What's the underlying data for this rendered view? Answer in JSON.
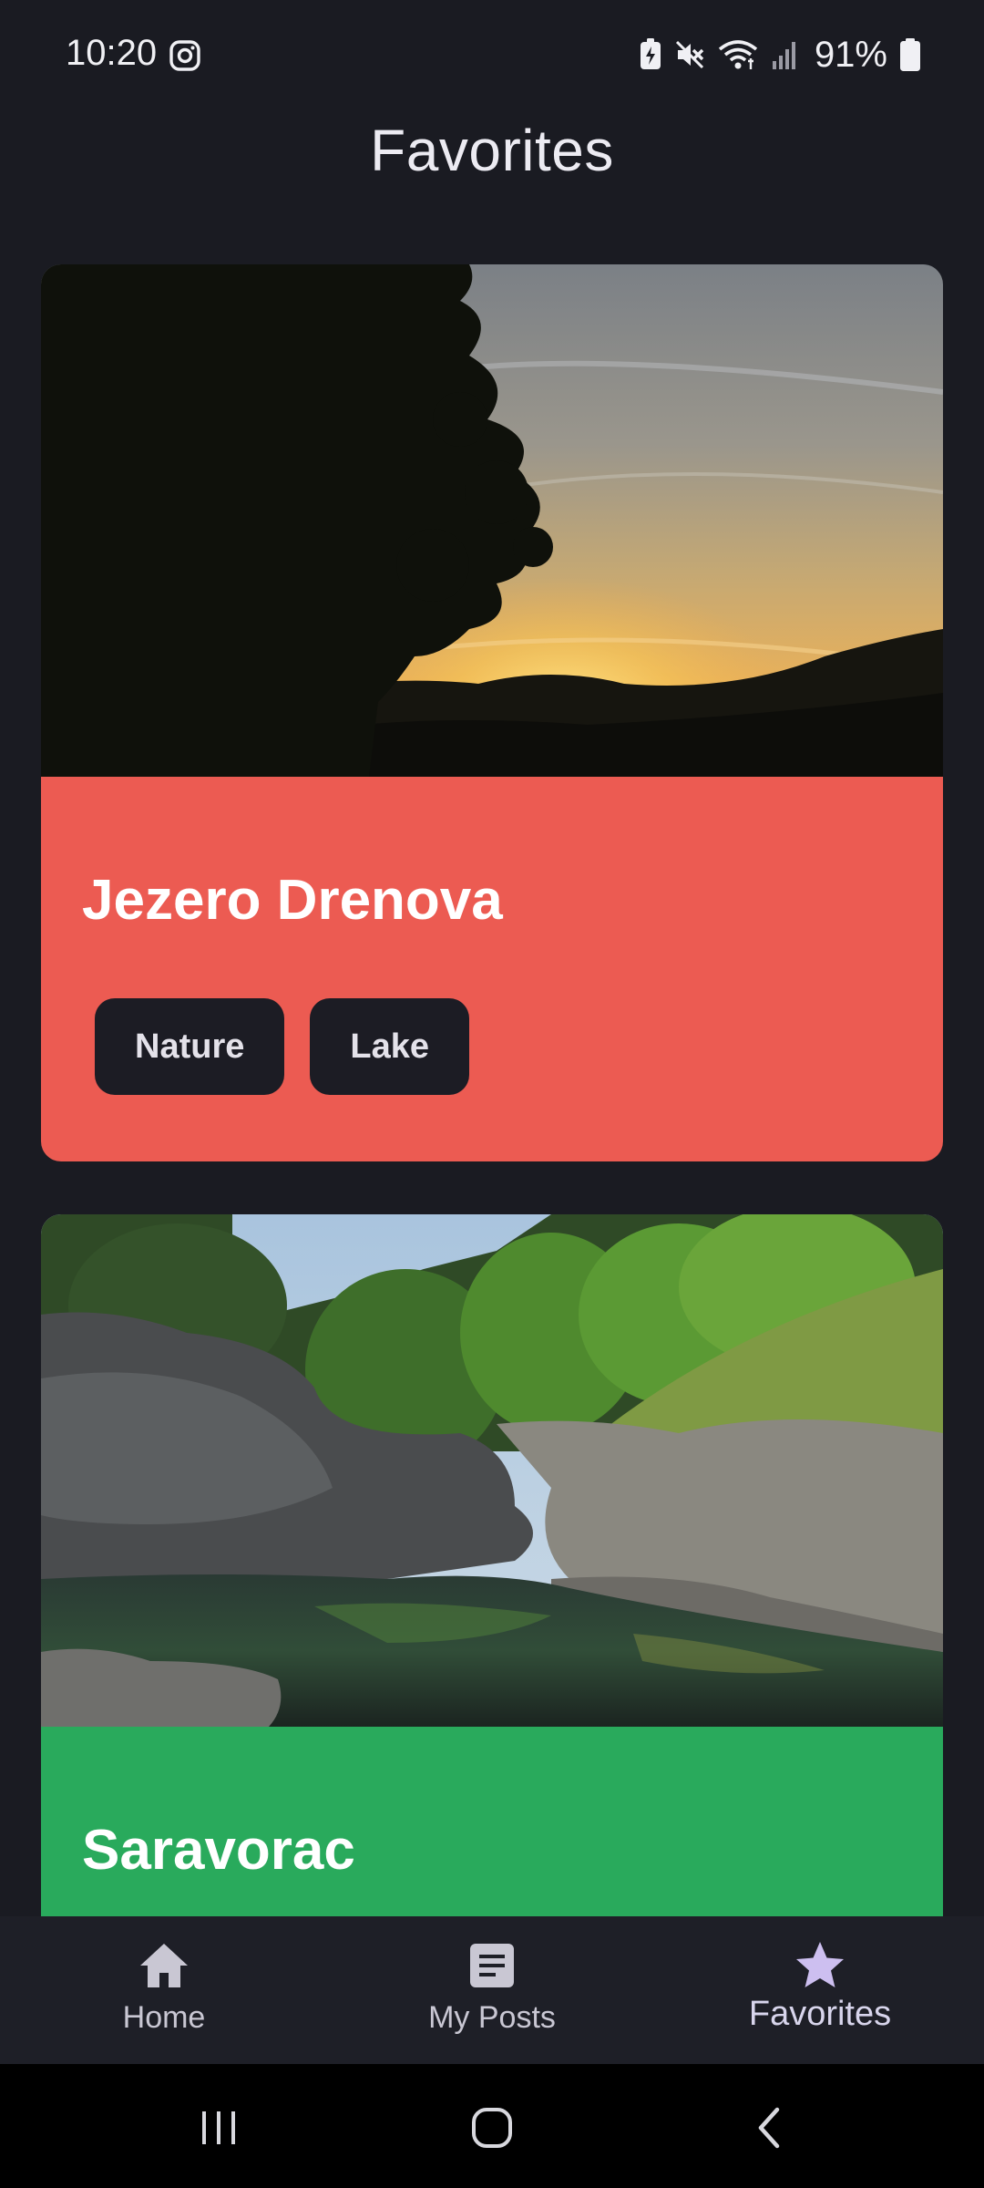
{
  "status_bar": {
    "time": "10:20",
    "battery_percent": "91%",
    "left_icons": [
      "instagram-icon"
    ],
    "right_icons": [
      "battery-saver-icon",
      "mute-icon",
      "wifi-icon",
      "signal-icon",
      "battery-icon"
    ]
  },
  "header": {
    "title": "Favorites"
  },
  "cards": [
    {
      "title": "Jezero Drenova",
      "tags": [
        "Nature",
        "Lake"
      ],
      "image": "sunset-lake-photo",
      "color": "#ec5b52"
    },
    {
      "title": "Saravorac",
      "tags": [],
      "image": "river-rocks-photo",
      "color": "#29aa5c"
    }
  ],
  "bottom_nav": {
    "items": [
      {
        "label": "Home",
        "icon": "home-icon",
        "active": false
      },
      {
        "label": "My Posts",
        "icon": "posts-icon",
        "active": false
      },
      {
        "label": "Favorites",
        "icon": "star-icon",
        "active": true
      }
    ],
    "active_color": "#cdbff0"
  },
  "system_nav": {
    "buttons": [
      "recents-icon",
      "home-circle-icon",
      "back-icon"
    ]
  }
}
